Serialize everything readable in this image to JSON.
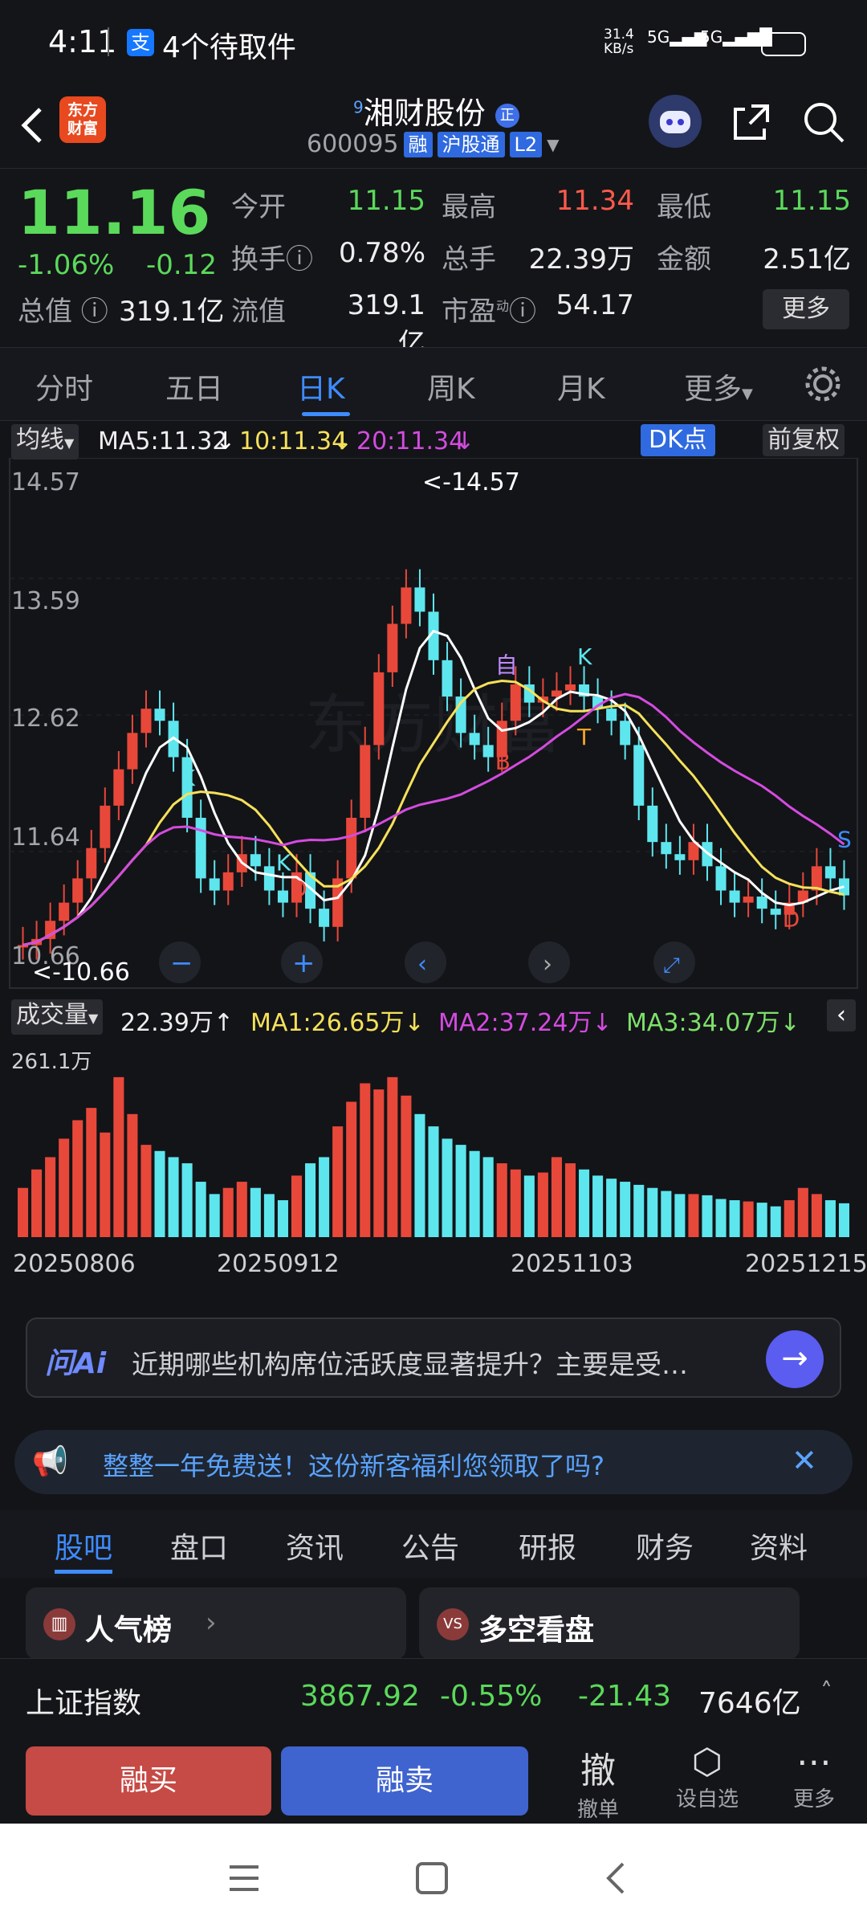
{
  "status": {
    "time": "4:11",
    "alipay": "支",
    "notice": "4个待取件",
    "net_speed": "31.4",
    "net_unit": "KB/s",
    "sig1": "5G",
    "sig2": "5G",
    "battery": "95"
  },
  "header": {
    "logo_line1": "东方",
    "logo_line2": "财富",
    "name": "湘财股份",
    "name_sup": "9",
    "code": "600095",
    "tags": [
      "融",
      "沪股通",
      "L2"
    ]
  },
  "quote": {
    "price": "11.16",
    "pct": "-1.06%",
    "chg": "-0.12",
    "open_label": "今开",
    "open": "11.15",
    "high_label": "最高",
    "high": "11.34",
    "low_label": "最低",
    "low": "11.15",
    "turnover_label": "换手",
    "turnover": "0.78%",
    "volume_label": "总手",
    "volume": "22.39万",
    "amount_label": "金额",
    "amount": "2.51亿",
    "mcap_label": "总值",
    "mcap": "319.1亿",
    "float_label": "流值",
    "float": "319.1亿",
    "pe_label": "市盈",
    "pe_sup": "动",
    "pe": "54.17",
    "more": "更多"
  },
  "period_tabs": [
    "分时",
    "五日",
    "日K",
    "周K",
    "月K",
    "更多"
  ],
  "ma_bar": {
    "sel": "均线",
    "ma5": "MA5:11.32",
    "ma10": "10:11.34",
    "ma20": "20:11.34",
    "dk": "DK点",
    "fq": "前复权"
  },
  "colors": {
    "up": "#e8483a",
    "down": "#5ee6ee",
    "ma5": "#ffffff",
    "ma10": "#f5e15a",
    "ma20": "#d44be0",
    "vma3": "#7ee06a",
    "accent": "#3e8cff"
  },
  "chart_data": {
    "type": "candlestick",
    "y_ticks": [
      "14.57",
      "13.59",
      "12.62",
      "11.64",
      "10.66"
    ],
    "ylim": [
      10.66,
      14.57
    ],
    "high_label": "<-14.57",
    "low_label": "<-10.66",
    "markers": [
      "K",
      "K",
      "D",
      "自",
      "B",
      "T",
      "K",
      "D",
      "S"
    ],
    "closes": [
      10.75,
      10.8,
      10.95,
      11.1,
      11.3,
      11.55,
      11.9,
      12.2,
      12.5,
      12.7,
      12.6,
      12.3,
      11.8,
      11.3,
      11.2,
      11.35,
      11.5,
      11.4,
      11.2,
      11.1,
      11.35,
      11.05,
      10.9,
      11.3,
      11.8,
      12.4,
      13.0,
      13.4,
      13.7,
      13.5,
      13.1,
      12.8,
      12.5,
      12.4,
      12.3,
      12.6,
      12.9,
      12.75,
      12.8,
      12.85,
      12.9,
      12.8,
      12.7,
      12.6,
      12.4,
      11.9,
      11.6,
      11.5,
      11.45,
      11.6,
      11.4,
      11.2,
      11.1,
      11.15,
      11.05,
      11.0,
      11.1,
      11.2,
      11.4,
      11.3,
      11.16
    ]
  },
  "vol_bar": {
    "sel": "成交量",
    "vol": "22.39万",
    "ma1": "MA1:26.65万",
    "ma2": "MA2:37.24万",
    "ma3": "MA3:34.07万",
    "top": "261.1万"
  },
  "vol_data": [
    80,
    110,
    130,
    160,
    190,
    210,
    170,
    260,
    200,
    150,
    140,
    130,
    120,
    90,
    70,
    80,
    90,
    80,
    70,
    60,
    100,
    120,
    130,
    180,
    220,
    250,
    240,
    260,
    230,
    200,
    180,
    160,
    150,
    140,
    130,
    120,
    110,
    100,
    105,
    130,
    120,
    110,
    100,
    95,
    90,
    85,
    80,
    75,
    70,
    70,
    68,
    62,
    60,
    58,
    56,
    50,
    60,
    80,
    70,
    60,
    55
  ],
  "dates": [
    "20250806",
    "20250912",
    "20251103",
    "20251215"
  ],
  "ai": {
    "logo": "问Ai",
    "text": "近期哪些机构席位活跃度显著提升？主要是受…"
  },
  "promo": {
    "text": "整整一年免费送！这份新客福利您领取了吗?"
  },
  "bottom_tabs": [
    "股吧",
    "盘口",
    "资讯",
    "公告",
    "研报",
    "财务",
    "资料"
  ],
  "cards": [
    {
      "label": "人气榜"
    },
    {
      "label": "多空看盘"
    }
  ],
  "index": {
    "name": "上证指数",
    "value": "3867.92",
    "pct": "-0.55%",
    "chg": "-21.43",
    "amount": "7646亿"
  },
  "actions": {
    "buy": "融买",
    "sell": "融卖",
    "cancel_icon": "撤",
    "cancel": "撤单",
    "watch": "设自选",
    "more": "更多"
  }
}
